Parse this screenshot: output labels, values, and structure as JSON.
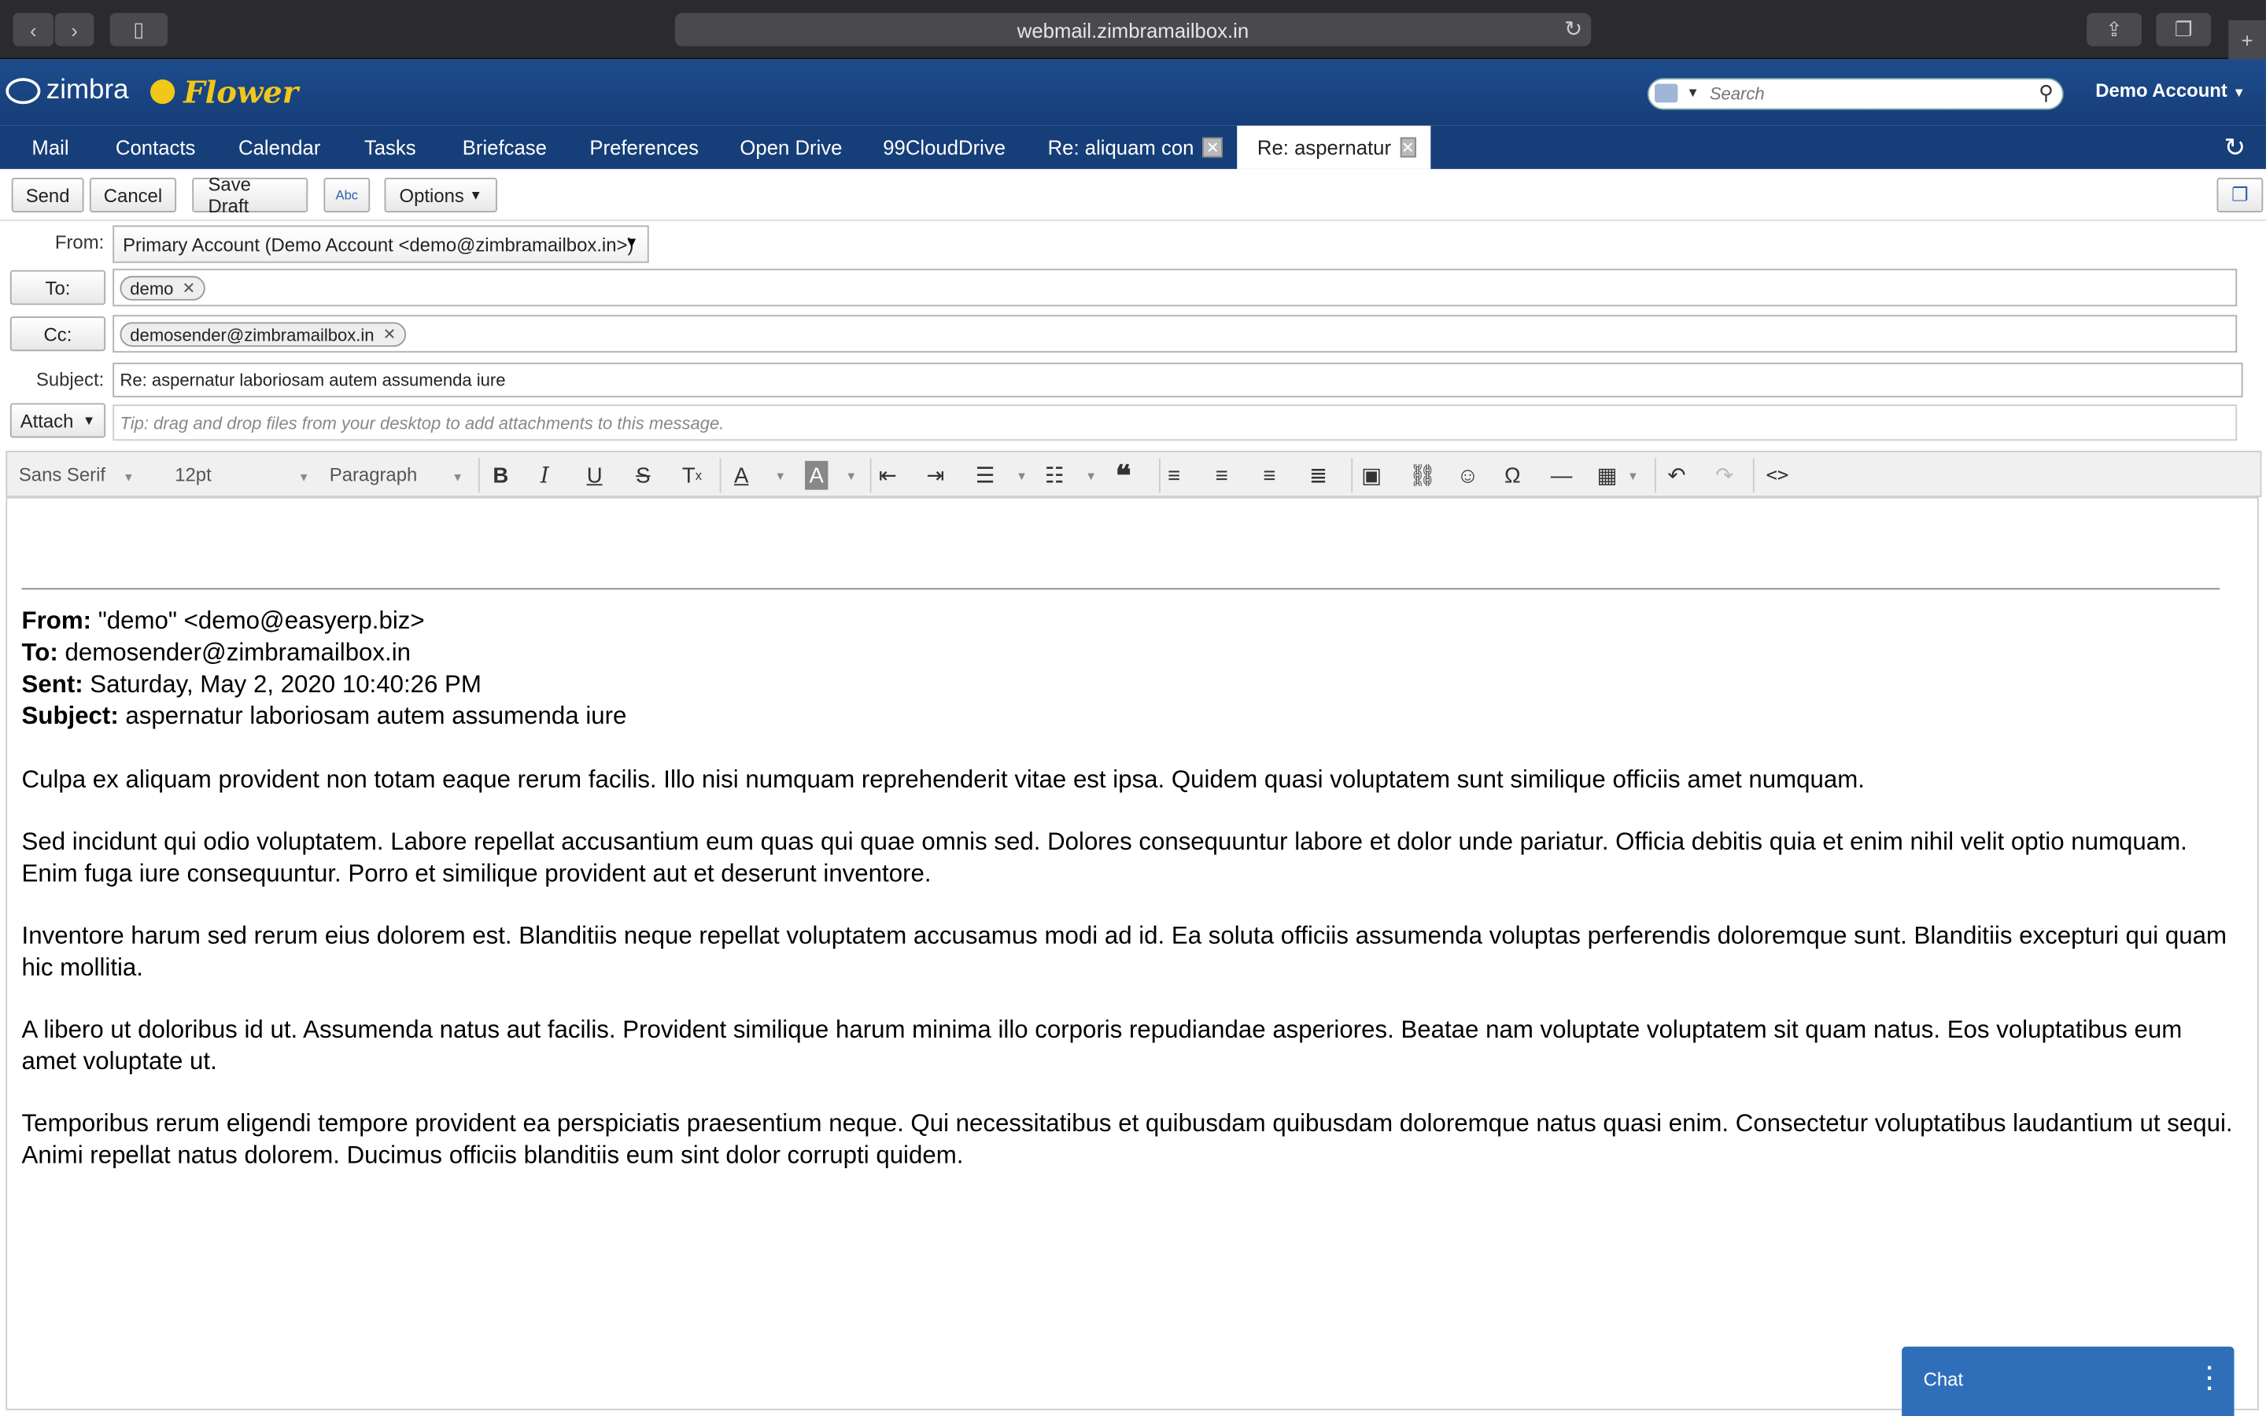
{
  "browser": {
    "url": "webmail.zimbramailbox.in"
  },
  "header": {
    "logo_text": "zimbra",
    "brand": "Flower",
    "search_placeholder": "Search",
    "account": "Demo Account"
  },
  "tabs": [
    "Mail",
    "Contacts",
    "Calendar",
    "Tasks",
    "Briefcase",
    "Preferences",
    "Open Drive",
    "99CloudDrive"
  ],
  "open_tabs": [
    {
      "label": "Re: aliquam con"
    },
    {
      "label": "Re: aspernatur"
    }
  ],
  "toolbar": {
    "send": "Send",
    "cancel": "Cancel",
    "save_draft": "Save Draft",
    "spell": "Abc",
    "options": "Options"
  },
  "compose": {
    "from_label": "From:",
    "from_value": "Primary Account (Demo Account <demo@zimbramailbox.in>)",
    "to_label": "To:",
    "to_recipient": "demo",
    "cc_label": "Cc:",
    "cc_recipient": "demosender@zimbramailbox.in",
    "subject_label": "Subject:",
    "subject_value": "Re: aspernatur laboriosam autem assumenda iure",
    "attach_label": "Attach",
    "attach_tip": "Tip: drag and drop files from your desktop to add attachments to this message."
  },
  "editor": {
    "font": "Sans Serif",
    "size": "12pt",
    "block": "Paragraph"
  },
  "quoted": {
    "from_key": "From:",
    "from_val": "\"demo\" <demo@easyerp.biz>",
    "to_key": "To:",
    "to_val": "demosender@zimbramailbox.in",
    "sent_key": "Sent:",
    "sent_val": "Saturday, May 2, 2020 10:40:26 PM",
    "subject_key": "Subject:",
    "subject_val": "aspernatur laboriosam autem assumenda iure",
    "paragraphs": [
      "Culpa ex aliquam provident non totam eaque rerum facilis. Illo nisi numquam reprehenderit vitae est ipsa. Quidem quasi voluptatem sunt similique officiis amet numquam.",
      "Sed incidunt qui odio voluptatem. Labore repellat accusantium eum quas qui quae omnis sed. Dolores consequuntur labore et dolor unde pariatur. Officia debitis quia et enim nihil velit optio numquam. Enim fuga iure consequuntur. Porro et similique provident aut et deserunt inventore.",
      "Inventore harum sed rerum eius dolorem est. Blanditiis neque repellat voluptatem accusamus modi ad id. Ea soluta officiis assumenda voluptas perferendis doloremque sunt. Blanditiis excepturi qui quam hic mollitia.",
      "A libero ut doloribus id ut. Assumenda natus aut facilis. Provident similique harum minima illo corporis repudiandae asperiores. Beatae nam voluptate voluptatem sit quam natus. Eos voluptatibus eum amet voluptate ut.",
      "Temporibus rerum eligendi tempore provident ea perspiciatis praesentium neque. Qui necessitatibus et quibusdam quibusdam doloremque natus quasi enim. Consectetur voluptatibus laudantium ut sequi. Animi repellat natus dolorem. Ducimus officiis blanditiis eum sint dolor corrupti quidem."
    ]
  },
  "chat": {
    "label": "Chat"
  }
}
